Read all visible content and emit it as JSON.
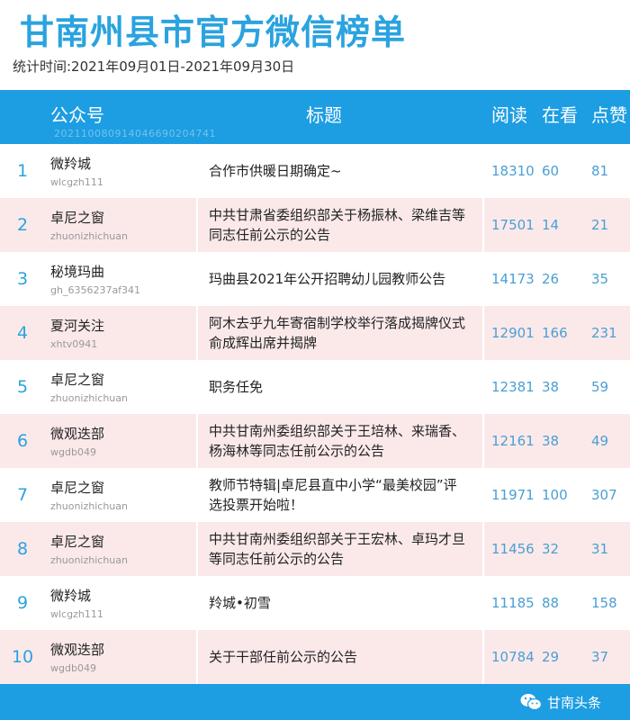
{
  "page_title": "甘南州县市官方微信榜单",
  "period": "统计时间:2021年09月01日-2021年09月30日",
  "header": {
    "account": "公众号",
    "title": "标题",
    "read": "阅读",
    "watching": "在看",
    "likes": "点赞",
    "code": "202110080914046690204741"
  },
  "rows": [
    {
      "rank": "1",
      "account": "微羚城",
      "account_id": "wlcgzh111",
      "title": "合作市供暖日期确定~",
      "read": "18310",
      "watching": "60",
      "likes": "81"
    },
    {
      "rank": "2",
      "account": "卓尼之窗",
      "account_id": "zhuonizhichuan",
      "title": "中共甘肃省委组织部关于杨振林、梁维吉等同志任前公示的公告",
      "read": "17501",
      "watching": "14",
      "likes": "21"
    },
    {
      "rank": "3",
      "account": "秘境玛曲",
      "account_id": "gh_6356237af341",
      "title": "玛曲县2021年公开招聘幼儿园教师公告",
      "read": "14173",
      "watching": "26",
      "likes": "35"
    },
    {
      "rank": "4",
      "account": "夏河关注",
      "account_id": "xhtv0941",
      "title": "阿木去乎九年寄宿制学校举行落成揭牌仪式  俞成辉出席并揭牌",
      "read": "12901",
      "watching": "166",
      "likes": "231"
    },
    {
      "rank": "5",
      "account": "卓尼之窗",
      "account_id": "zhuonizhichuan",
      "title": "职务任免",
      "read": "12381",
      "watching": "38",
      "likes": "59"
    },
    {
      "rank": "6",
      "account": "微观迭部",
      "account_id": "wgdb049",
      "title": "中共甘南州委组织部关于王培林、来瑞香、杨海林等同志任前公示的公告",
      "read": "12161",
      "watching": "38",
      "likes": "49"
    },
    {
      "rank": "7",
      "account": "卓尼之窗",
      "account_id": "zhuonizhichuan",
      "title": "教师节特辑|卓尼县直中小学“最美校园”评选投票开始啦！",
      "read": "11971",
      "watching": "100",
      "likes": "307"
    },
    {
      "rank": "8",
      "account": "卓尼之窗",
      "account_id": "zhuonizhichuan",
      "title": "中共甘南州委组织部关于王宏林、卓玛才旦等同志任前公示的公告",
      "read": "11456",
      "watching": "32",
      "likes": "31"
    },
    {
      "rank": "9",
      "account": "微羚城",
      "account_id": "wlcgzh111",
      "title": "羚城•初雪",
      "read": "11185",
      "watching": "88",
      "likes": "158"
    },
    {
      "rank": "10",
      "account": "微观迭部",
      "account_id": "wgdb049",
      "title": "关于干部任前公示的公告",
      "read": "10784",
      "watching": "29",
      "likes": "37"
    }
  ],
  "watermark": "甘南头条",
  "colors": {
    "header_blue": "#1d9de2",
    "title_blue": "#2aa3df",
    "alt_row_pink": "#fbe9ea",
    "number_blue": "#4a9fd3"
  }
}
